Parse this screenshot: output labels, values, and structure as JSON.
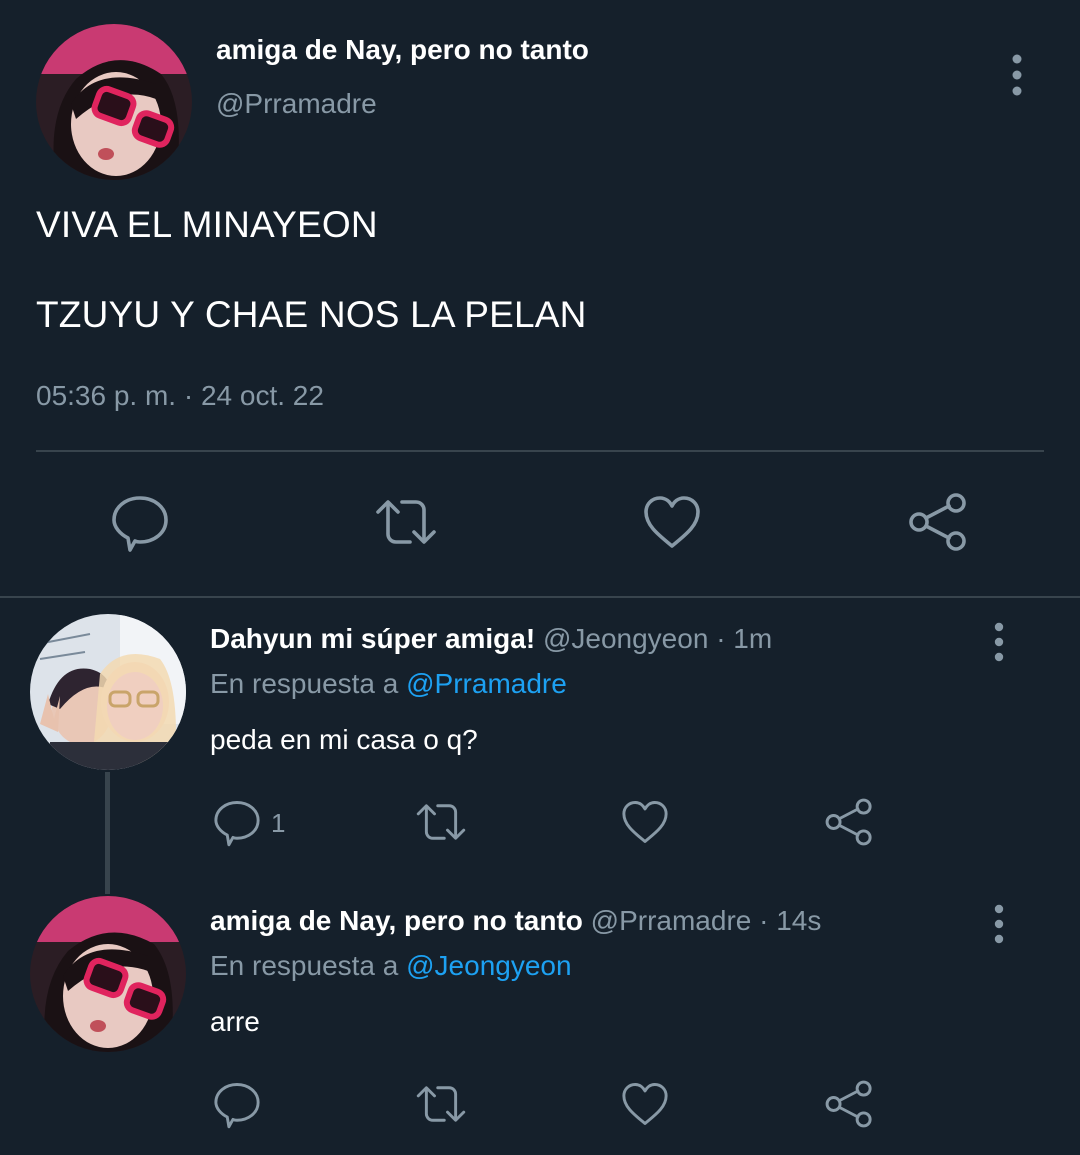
{
  "main_tweet": {
    "author_name": "amiga de Nay, pero no tanto",
    "author_handle": "@Prramadre",
    "text_line_1": "VIVA EL MINAYEON",
    "text_line_2": "TZUYU Y CHAE NOS LA PELAN",
    "timestamp": "05:36 p. m. · 24 oct. 22"
  },
  "replies": [
    {
      "author_name": "Dahyun mi súper amiga!",
      "author_handle": "@Jeongyeon",
      "age": "· 1m",
      "reply_prefix": "En respuesta a",
      "reply_to": "@Prramadre",
      "text": "peda en mi casa o q?",
      "reply_count": "1"
    },
    {
      "author_name": "amiga de Nay, pero no tanto",
      "author_handle": "@Prramadre",
      "age": "· 14s",
      "reply_prefix": "En respuesta a",
      "reply_to": "@Jeongyeon",
      "text": "arre",
      "reply_count": ""
    }
  ],
  "icons": {
    "reply": "speech-bubble-icon",
    "retweet": "retweet-arrows-icon",
    "like": "heart-icon",
    "share": "share-nodes-icon",
    "more": "vertical-dots-icon"
  },
  "colors": {
    "background": "#15202b",
    "text_primary": "#ffffff",
    "text_secondary": "#8899a6",
    "mention": "#1da1f2",
    "divider": "#38444d"
  }
}
